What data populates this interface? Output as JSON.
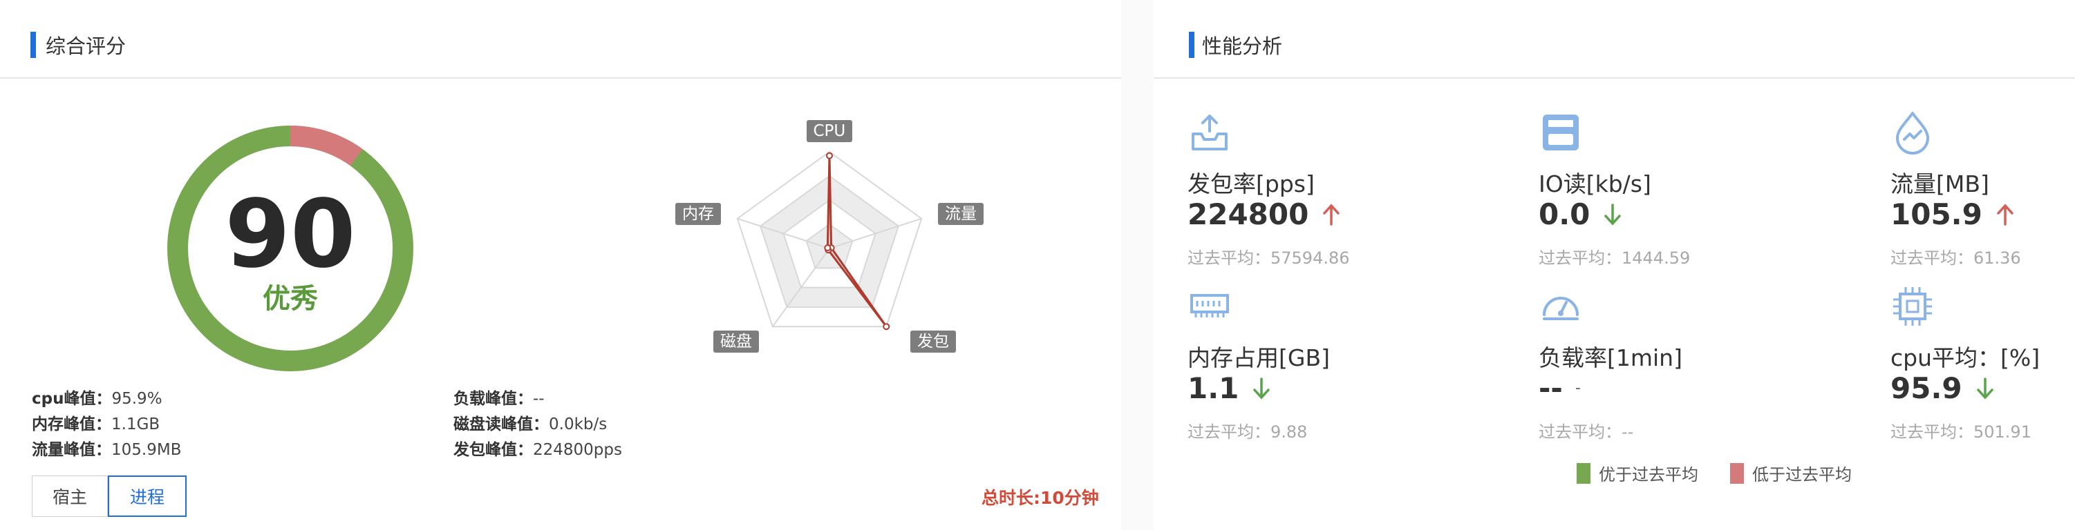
{
  "left_panel": {
    "title": "综合评分",
    "score": "90",
    "grade": "优秀",
    "stats_col1": [
      {
        "label": "cpu峰值：",
        "value": "95.9%"
      },
      {
        "label": "内存峰值：",
        "value": "1.1GB"
      },
      {
        "label": "流量峰值：",
        "value": "105.9MB"
      }
    ],
    "stats_col2": [
      {
        "label": "负载峰值：",
        "value": "--"
      },
      {
        "label": "磁盘读峰值：",
        "value": "0.0kb/s"
      },
      {
        "label": "发包峰值：",
        "value": "224800pps"
      }
    ],
    "buttons": {
      "host": "宿主",
      "process": "进程"
    },
    "duration": "总时长:10分钟",
    "gauge": {
      "good_fraction": 0.9,
      "good_color": "#77a84f",
      "bad_color": "#d57a7a"
    },
    "radar": {
      "labels": [
        "CPU",
        "流量",
        "发包",
        "磁盘",
        "内存"
      ],
      "values": [
        0.96,
        0.0,
        1.0,
        0.0,
        0.0
      ],
      "line_color": "#b03a2e"
    }
  },
  "right_panel": {
    "title": "性能分析",
    "metrics": [
      {
        "name": "发包率[pps]",
        "value": "224800",
        "trend": "up",
        "avg": "过去平均：57594.86",
        "icon": "upload-tray-icon"
      },
      {
        "name": "IO读[kb/s]",
        "value": "0.0",
        "trend": "down",
        "avg": "过去平均：1444.59",
        "icon": "floppy-disk-icon"
      },
      {
        "name": "流量[MB]",
        "value": "105.9",
        "trend": "up",
        "avg": "过去平均：61.36",
        "icon": "droplet-icon"
      },
      {
        "name": "内存占用[GB]",
        "value": "1.1",
        "trend": "down",
        "avg": "过去平均：9.88",
        "icon": "memory-chip-icon"
      },
      {
        "name": "负载率[1min]",
        "value": "--",
        "trend": "none",
        "avg": "过去平均：--",
        "icon": "speedometer-icon"
      },
      {
        "name": "cpu平均：[%]",
        "value": "95.9",
        "trend": "down",
        "avg": "过去平均：501.91",
        "icon": "cpu-icon"
      }
    ],
    "legend": [
      {
        "label": "优于过去平均",
        "color": "#77a84f"
      },
      {
        "label": "低于过去平均",
        "color": "#d57a7a"
      }
    ]
  },
  "colors": {
    "accent": "#1f6fd6",
    "up_arrow": "#d55e55",
    "down_arrow": "#5aa34a",
    "icon": "#8ab3e6"
  }
}
